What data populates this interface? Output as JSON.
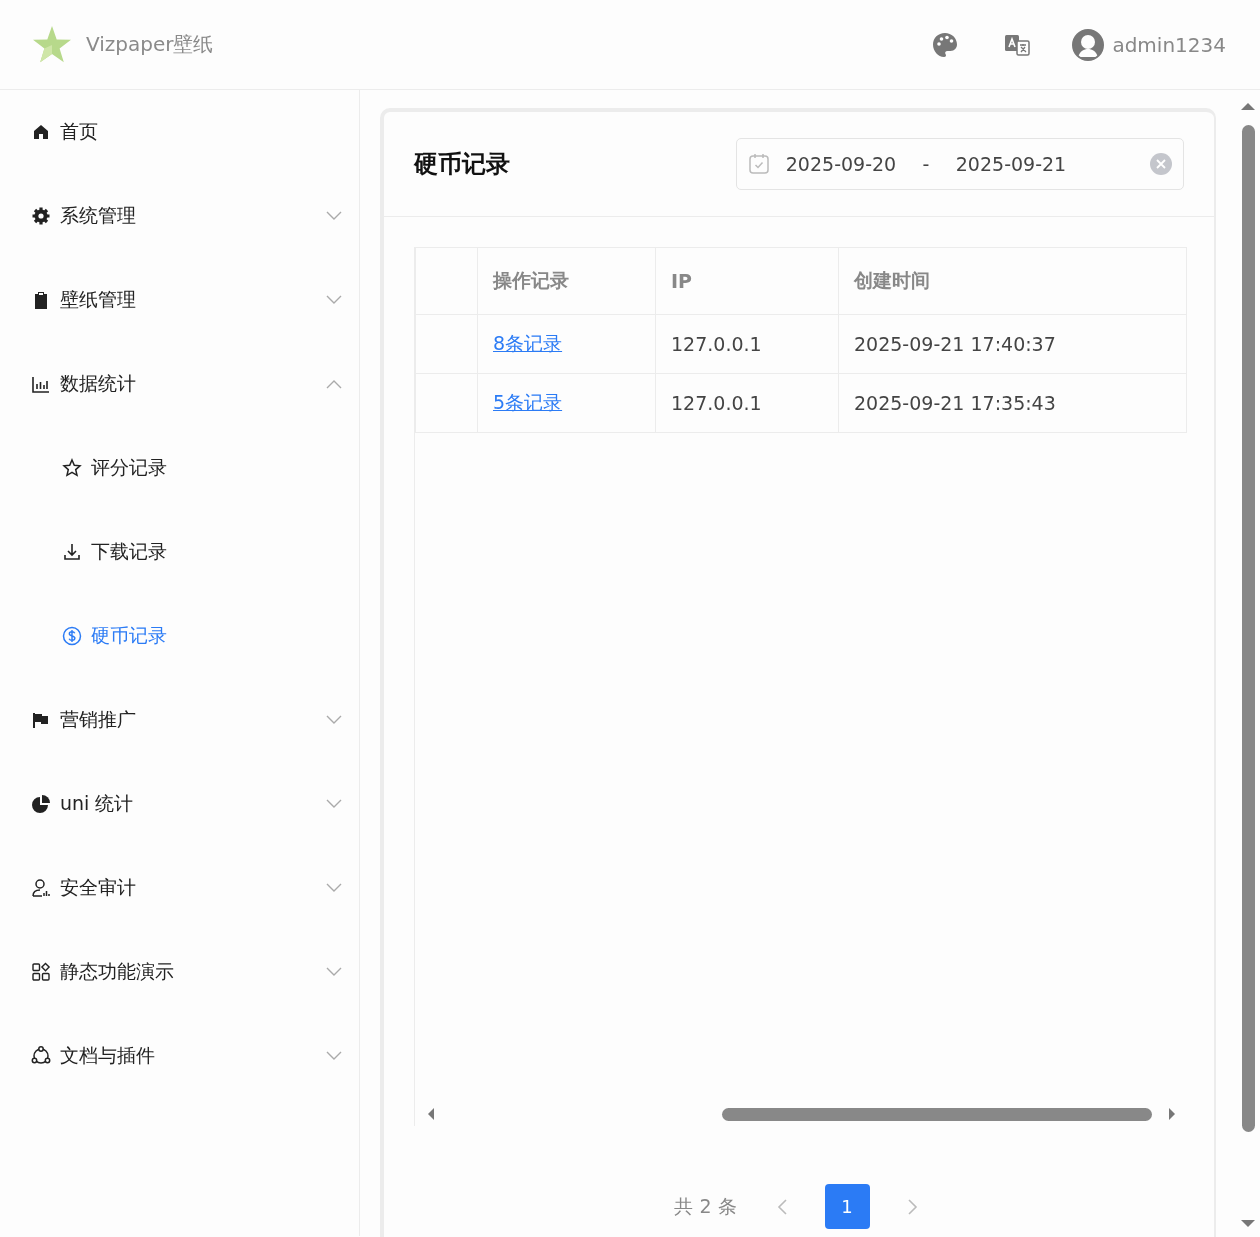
{
  "header": {
    "brand": "Vizpaper壁纸",
    "username": "admin1234"
  },
  "sidebar": {
    "items": [
      {
        "kind": "link",
        "label": "首页",
        "selected": false
      },
      {
        "kind": "group",
        "label": "系统管理",
        "expanded": false
      },
      {
        "kind": "group",
        "label": "壁纸管理",
        "expanded": false
      },
      {
        "kind": "group",
        "label": "数据统计",
        "expanded": true,
        "children": [
          {
            "label": "评分记录",
            "selected": false
          },
          {
            "label": "下载记录",
            "selected": false
          },
          {
            "label": "硬币记录",
            "selected": true
          }
        ]
      },
      {
        "kind": "group",
        "label": "营销推广",
        "expanded": false
      },
      {
        "kind": "group",
        "label": "uni 统计",
        "expanded": false
      },
      {
        "kind": "group",
        "label": "安全审计",
        "expanded": false
      },
      {
        "kind": "group",
        "label": "静态功能演示",
        "expanded": false
      },
      {
        "kind": "group",
        "label": "文档与插件",
        "expanded": false
      }
    ]
  },
  "card": {
    "title": "硬币记录",
    "date_range": {
      "start": "2025-09-20",
      "separator": "-",
      "end": "2025-09-21"
    },
    "table": {
      "columns": [
        "操作记录",
        "IP",
        "创建时间"
      ],
      "rows": [
        {
          "cells": [
            "8条记录",
            "127.0.0.1",
            "2025-09-21 17:40:37"
          ]
        },
        {
          "cells": [
            "5条记录",
            "127.0.0.1",
            "2025-09-21 17:35:43"
          ]
        }
      ]
    },
    "pagination": {
      "total": "共 2 条",
      "pages": [
        {
          "label": "1",
          "selected": true
        }
      ]
    }
  }
}
